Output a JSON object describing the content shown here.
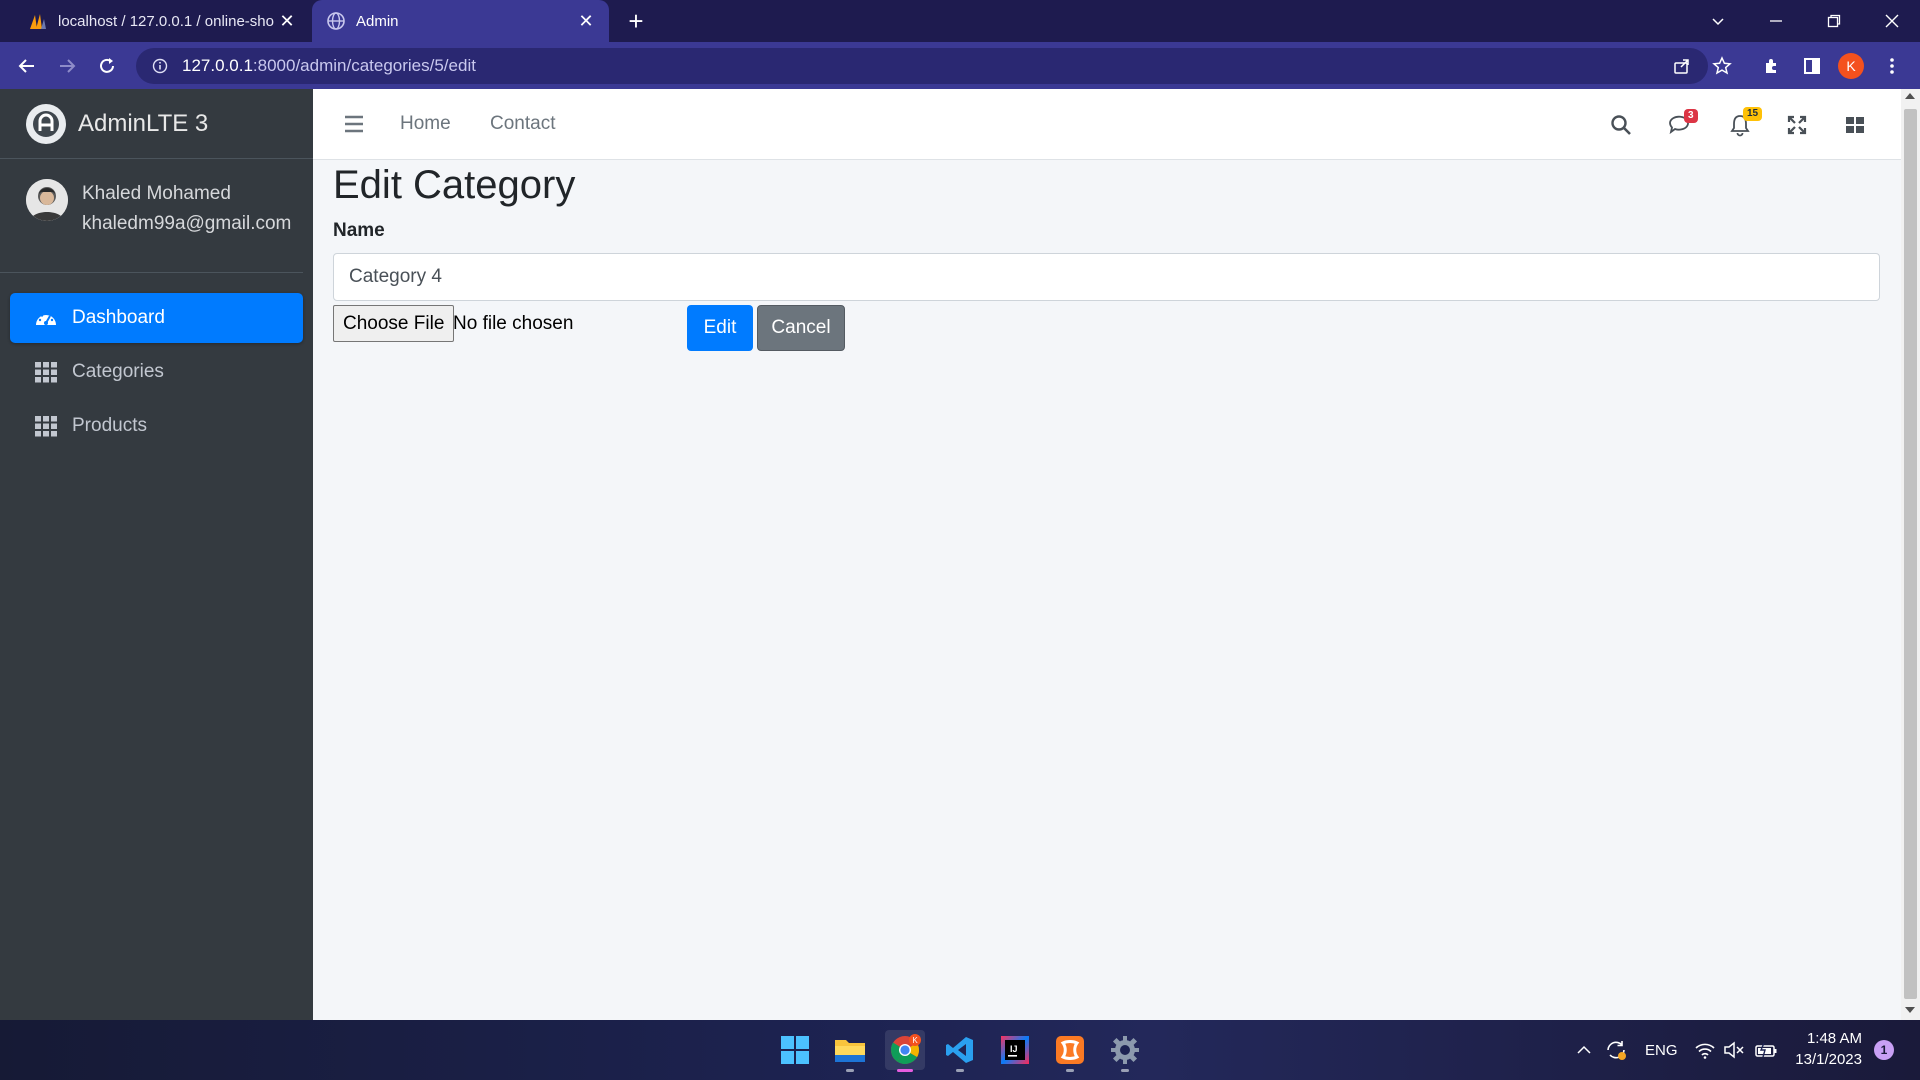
{
  "browser": {
    "tabs": [
      {
        "title": "localhost / 127.0.0.1 / online-sho",
        "icon": "phpmyadmin-icon",
        "active": false
      },
      {
        "title": "Admin",
        "icon": "globe-icon",
        "active": true
      }
    ],
    "url_host": "127.0.0.1",
    "url_path": ":8000/admin/categories/5/edit",
    "profile_initial": "K"
  },
  "sidebar": {
    "brand": "AdminLTE 3",
    "user": {
      "name": "Khaled Mohamed",
      "email": "khaledm99a@gmail.com"
    },
    "items": [
      {
        "label": "Dashboard",
        "icon": "dashboard-icon",
        "active": true
      },
      {
        "label": "Categories",
        "icon": "grid-icon",
        "active": false
      },
      {
        "label": "Products",
        "icon": "grid-icon",
        "active": false
      }
    ]
  },
  "topnav": {
    "links": [
      "Home",
      "Contact"
    ],
    "messages_badge": "3",
    "notifications_badge": "15"
  },
  "main": {
    "title": "Edit Category",
    "name_label": "Name",
    "name_value": "Category 4",
    "file_button": "Choose File",
    "file_status": "No file chosen",
    "submit_label": "Edit",
    "cancel_label": "Cancel"
  },
  "taskbar": {
    "language": "ENG",
    "time": "1:48 AM",
    "date": "13/1/2023",
    "notification_count": "1"
  },
  "colors": {
    "primary": "#007bff",
    "secondary": "#6c757d",
    "sidebar": "#343a40",
    "browser_frame": "#3b3994",
    "badge_danger": "#dc3545",
    "badge_warning": "#ffc107"
  }
}
